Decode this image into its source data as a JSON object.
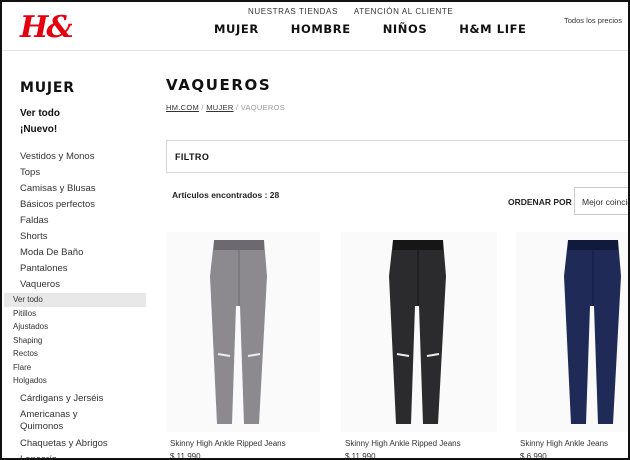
{
  "brand": {
    "logo_text": "H&M"
  },
  "header": {
    "top_links": [
      "NUESTRAS TIENDAS",
      "ATENCIÓN AL CLIENTE"
    ],
    "main_nav": [
      "MUJER",
      "HOMBRE",
      "NIÑOS",
      "H&M LIFE"
    ],
    "prices_note": "Todos los precios"
  },
  "sidebar": {
    "title": "MUJER",
    "ver_todo": "Ver todo",
    "nuevo": "¡Nuevo!",
    "items": [
      "Vestidos y Monos",
      "Tops",
      "Camisas y Blusas",
      "Básicos perfectos",
      "Faldas",
      "Shorts",
      "Moda De Baño",
      "Pantalones",
      "Vaqueros"
    ],
    "subitems": [
      "Ver todo",
      "Pitillos",
      "Ajustados",
      "Shaping",
      "Rectos",
      "Flare",
      "Holgados"
    ],
    "after_items": [
      "Cárdigans y Jerséis",
      "Americanas y Quimonos",
      "Chaquetas y Abrigos",
      "Lencería"
    ]
  },
  "main": {
    "title": "VAQUEROS",
    "breadcrumb": {
      "home": "HM.COM",
      "sep1": " / ",
      "section": "MUJER",
      "sep2": " / ",
      "current": "VAQUEROS"
    },
    "filter_label": "FILTRO",
    "found_text": "Artículos encontrados : 28",
    "order_label": "ORDENAR POR",
    "order_value": "Mejor coincidencia"
  },
  "products": [
    {
      "name": "Skinny High Ankle Ripped Jeans",
      "price": "$ 11.990",
      "color": "#8c8a8f",
      "color_dark": "#6c6a70"
    },
    {
      "name": "Skinny High Ankle Ripped Jeans",
      "price": "$ 11.990",
      "color": "#2b2b2d",
      "color_dark": "#161617"
    },
    {
      "name": "Skinny High Ankle Jeans",
      "price": "$ 6.990",
      "color": "#1f2a57",
      "color_dark": "#111a3c"
    }
  ]
}
